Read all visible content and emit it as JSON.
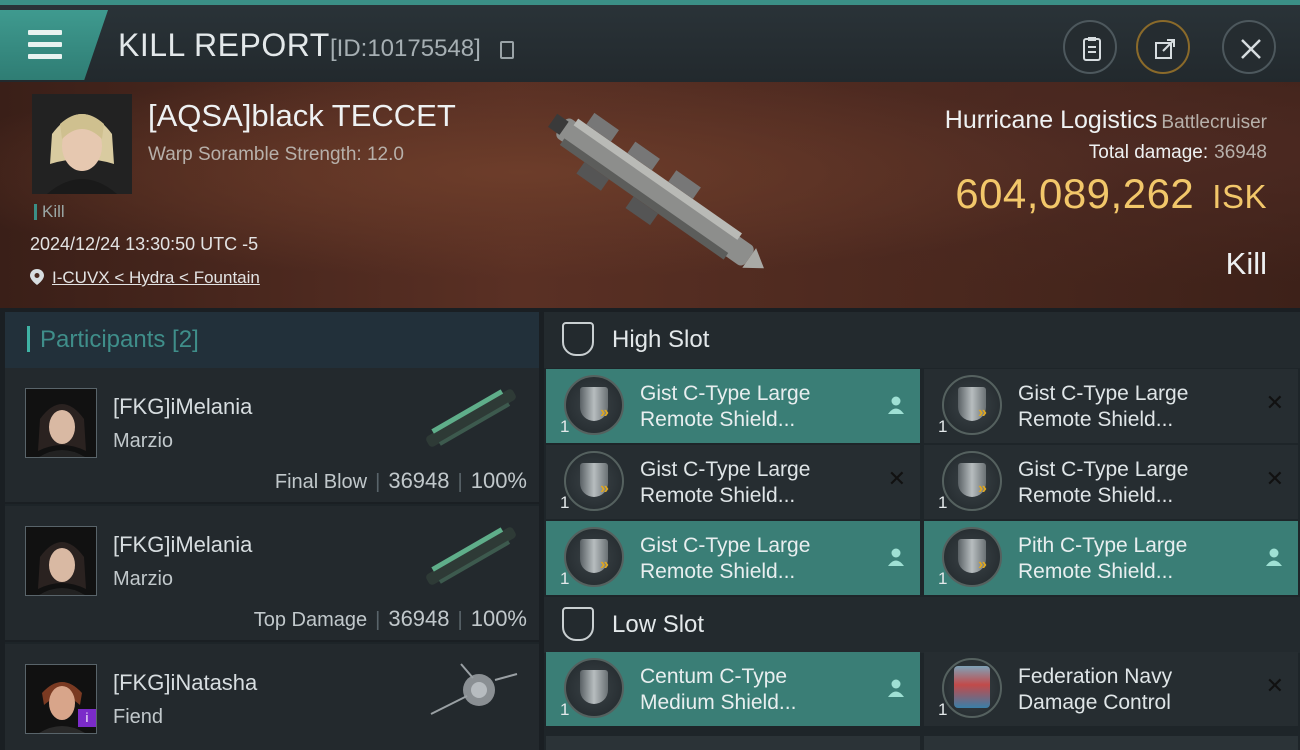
{
  "header": {
    "title": "KILL REPORT",
    "id_text": "[ID:10175548]"
  },
  "victim": {
    "name": "[AQSA]black TECCET",
    "scramble": "Warp Soramble Strength: 12.0",
    "kill_tag": "Kill",
    "datetime": "2024/12/24 13:30:50 UTC -5",
    "location": "I-CUVX < Hydra < Fountain"
  },
  "ship": {
    "name": "Hurricane Logistics",
    "class": "Battlecruiser",
    "total_damage_label": "Total damage:",
    "total_damage": "36948",
    "isk_value": "604,089,262",
    "isk_unit": "ISK",
    "result": "Kill"
  },
  "participants": {
    "title": "Participants [2]",
    "rows": [
      {
        "name": "[FKG]iMelania",
        "ship": "Marzio",
        "role": "Final Blow",
        "damage": "36948",
        "percent": "100%"
      },
      {
        "name": "[FKG]iMelania",
        "ship": "Marzio",
        "role": "Top Damage",
        "damage": "36948",
        "percent": "100%"
      },
      {
        "name": "[FKG]iNatasha",
        "ship": "Fiend",
        "badge": "i"
      }
    ]
  },
  "slots": {
    "high_title": "High Slot",
    "low_title": "Low Slot",
    "high": [
      {
        "line1": "Gist C-Type Large",
        "line2": "Remote Shield...",
        "qty": "1",
        "state": "fitted"
      },
      {
        "line1": "Gist C-Type Large",
        "line2": "Remote Shield...",
        "qty": "1",
        "state": "destroyed"
      },
      {
        "line1": "Gist C-Type Large",
        "line2": "Remote Shield...",
        "qty": "1",
        "state": "destroyed"
      },
      {
        "line1": "Gist C-Type Large",
        "line2": "Remote Shield...",
        "qty": "1",
        "state": "destroyed"
      },
      {
        "line1": "Gist C-Type Large",
        "line2": "Remote Shield...",
        "qty": "1",
        "state": "fitted"
      },
      {
        "line1": "Pith C-Type Large",
        "line2": "Remote Shield...",
        "qty": "1",
        "state": "fitted"
      }
    ],
    "low": [
      {
        "line1": "Centum C-Type",
        "line2": "Medium Shield...",
        "qty": "1",
        "state": "fitted"
      },
      {
        "line1": "Federation Navy",
        "line2": "Damage Control",
        "qty": "1",
        "state": "destroyed"
      }
    ]
  },
  "colors": {
    "accent": "#3b8f86",
    "fitted": "#3a7e76",
    "isk": "#f2c76a"
  }
}
